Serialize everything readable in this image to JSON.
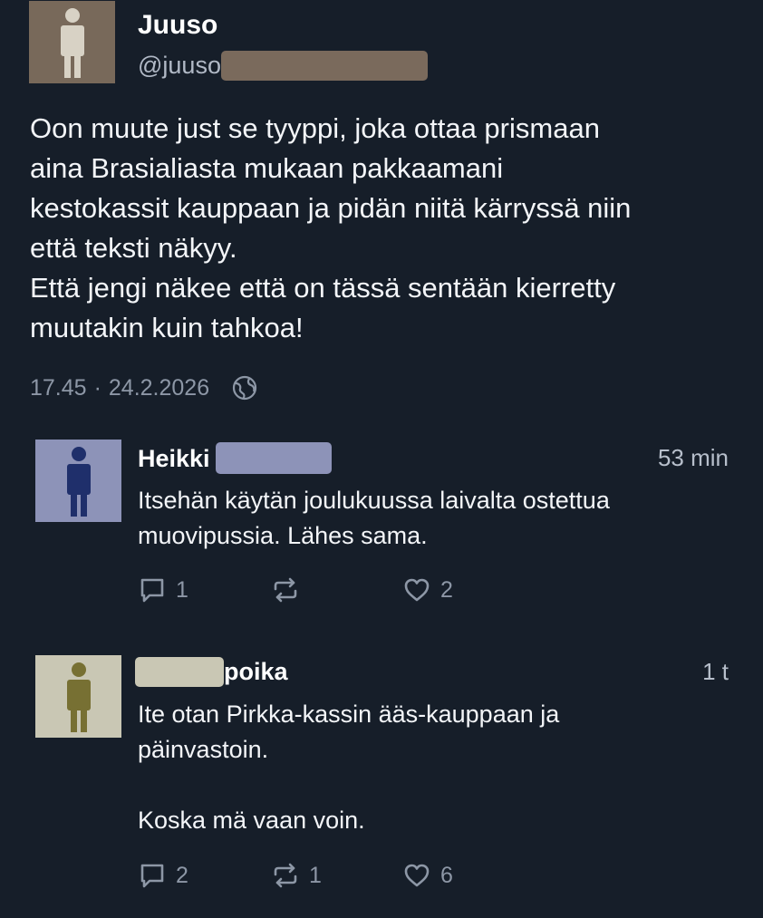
{
  "post": {
    "author_name": "Juuso",
    "handle": "@juuso",
    "body_lines": [
      "Oon muute just se tyyppi, joka ottaa prismaan",
      "aina Brasialiasta mukaan pakkaamani",
      "kestokassit kauppaan ja pidän niitä kärryssä niin",
      "että teksti näkyy.",
      "Että jengi näkee että on tässä sentään kierretty",
      "muutakin kuin tahkoa!"
    ],
    "time": "17.45",
    "separator": "·",
    "date": "24.2.2026",
    "avatar_color": "#78695a"
  },
  "replies": [
    {
      "name_prefix": "Heikki",
      "name_suffix": "",
      "time": "53 min",
      "body_lines": [
        "Itsehän käytän joulukuussa laivalta ostettua",
        "muovipussia. Lähes sama."
      ],
      "reply_count": "1",
      "repost_count": "",
      "like_count": "2",
      "avatar_color": "#8d93b8",
      "figure_color": "#1f2f6b",
      "redact_color": "#8d93b8"
    },
    {
      "name_prefix": "",
      "name_suffix": "poika",
      "time": "1 t",
      "body_lines": [
        "Ite otan Pirkka-kassin ääs-kauppaan ja",
        "päinvastoin.",
        "",
        "Koska mä vaan voin."
      ],
      "reply_count": "2",
      "repost_count": "1",
      "like_count": "6",
      "avatar_color": "#c9c7b4",
      "figure_color": "#777033",
      "redact_color": "#c9c7b4"
    }
  ]
}
